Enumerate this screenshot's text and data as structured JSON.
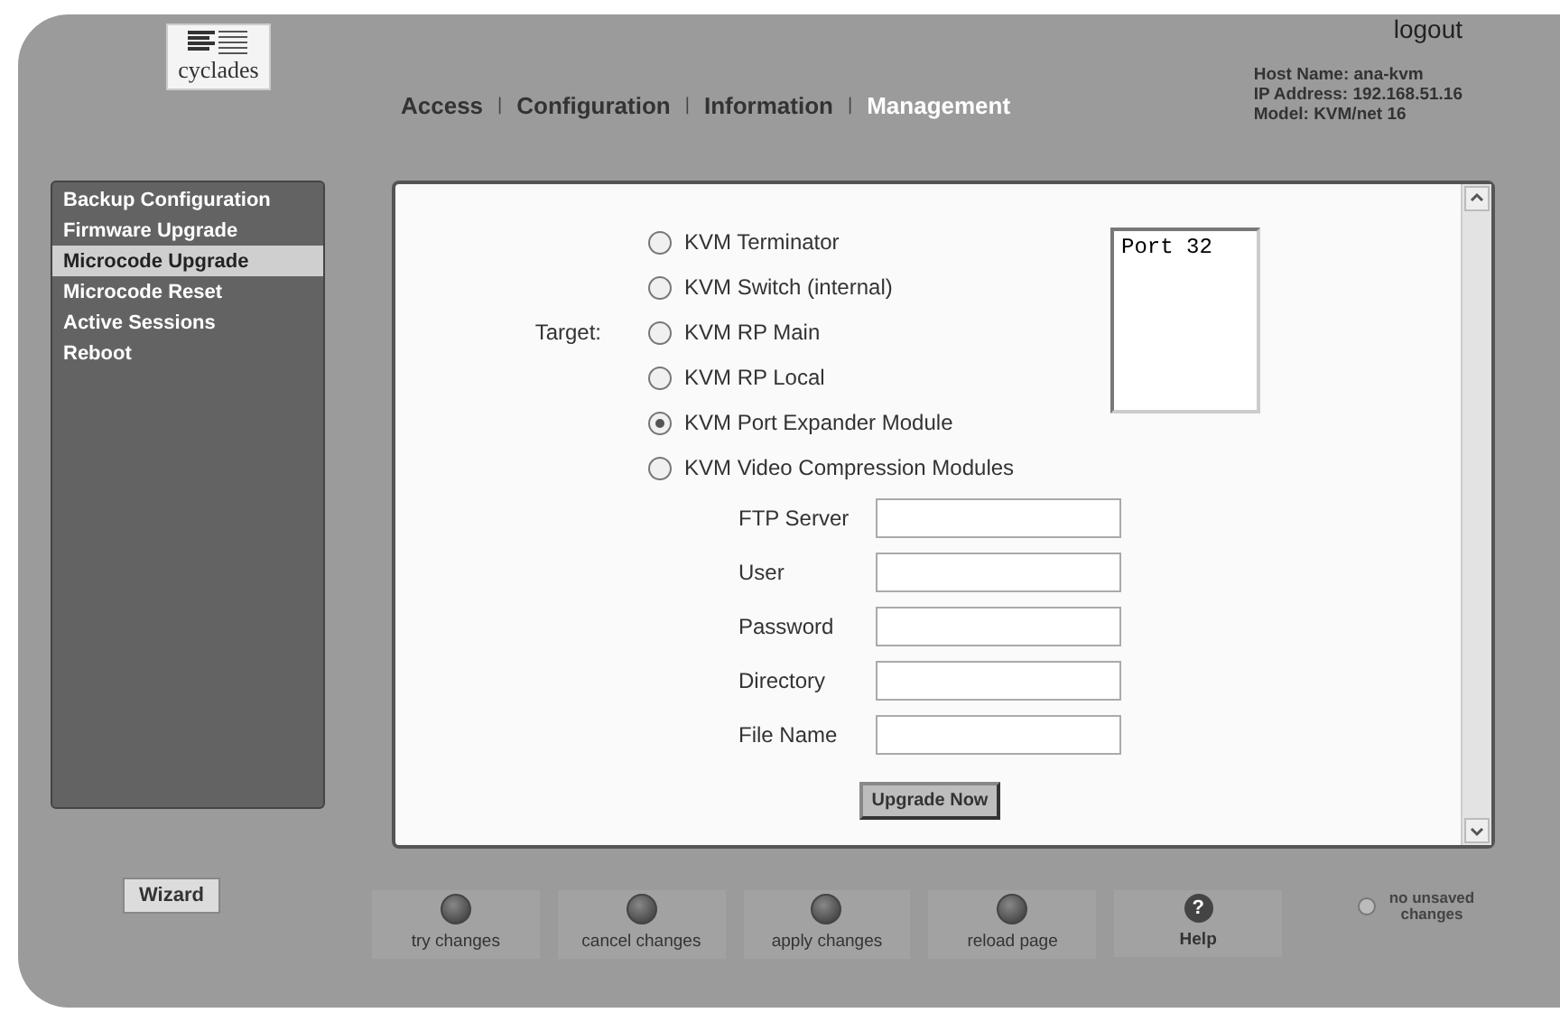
{
  "header": {
    "logo": "cyclades",
    "logout": "logout",
    "nav": [
      {
        "label": "Access",
        "selected": false
      },
      {
        "label": "Configuration",
        "selected": false
      },
      {
        "label": "Information",
        "selected": false
      },
      {
        "label": "Management",
        "selected": true
      }
    ],
    "separators": [
      "|",
      "|",
      "|"
    ],
    "host_info": [
      "Host Name: ana-kvm",
      "IP Address: 192.168.51.16",
      "Model: KVM/net 16"
    ]
  },
  "sidebar": {
    "items": [
      {
        "label": "Backup Configuration",
        "selected": false
      },
      {
        "label": "Firmware Upgrade",
        "selected": false
      },
      {
        "label": "Microcode Upgrade",
        "selected": true
      },
      {
        "label": "Microcode Reset",
        "selected": false
      },
      {
        "label": "Active Sessions",
        "selected": false
      },
      {
        "label": "Reboot",
        "selected": false
      }
    ],
    "wizard": "Wizard"
  },
  "form": {
    "target_label": "Target:",
    "targets": [
      {
        "label": "KVM Terminator",
        "selected": false
      },
      {
        "label": "KVM Switch (internal)",
        "selected": false
      },
      {
        "label": "KVM RP Main",
        "selected": false
      },
      {
        "label": "KVM RP Local",
        "selected": false
      },
      {
        "label": "KVM Port Expander Module",
        "selected": true
      },
      {
        "label": "KVM Video Compression Modules",
        "selected": false
      }
    ],
    "port_list": [
      "Port 32"
    ],
    "fields": [
      {
        "label": "FTP Server"
      },
      {
        "label": "User"
      },
      {
        "label": "Password"
      },
      {
        "label": "Directory"
      },
      {
        "label": "File Name"
      }
    ],
    "submit": "Upgrade Now"
  },
  "actions": [
    {
      "label": "try changes",
      "kind": "button"
    },
    {
      "label": "cancel changes",
      "kind": "button"
    },
    {
      "label": "apply changes",
      "kind": "button"
    },
    {
      "label": "reload page",
      "kind": "button"
    },
    {
      "label": "Help",
      "kind": "help",
      "icon": "?"
    }
  ],
  "status": {
    "text": "no unsaved changes",
    "unsaved": false
  }
}
